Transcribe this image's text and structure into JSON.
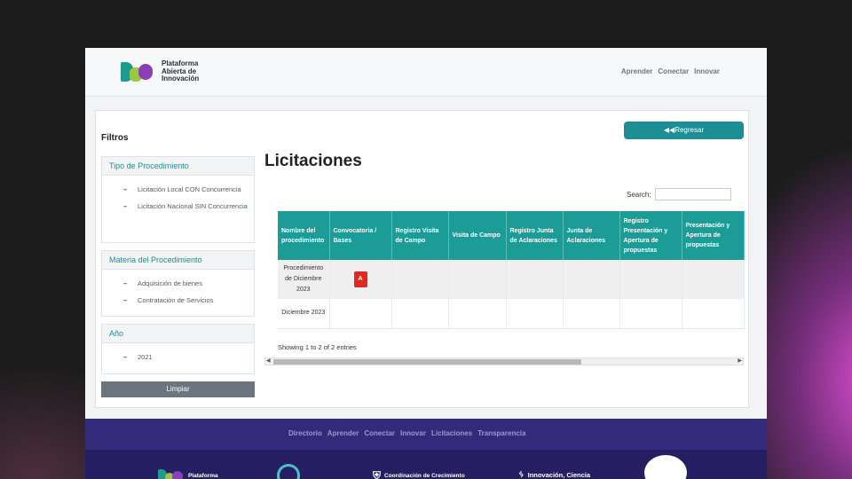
{
  "header": {
    "logo_text": "Plataforma Abierta de Innovación",
    "nav": [
      "Aprender",
      "Conectar",
      "Innovar"
    ]
  },
  "filters": {
    "title": "Filtros",
    "groups": [
      {
        "title": "Tipo de Procedimiento",
        "items": [
          "Licitación Local CON Concurrencia",
          "Licitación Nacional SIN Concurrencia"
        ]
      },
      {
        "title": "Materia del Procedimiento",
        "items": [
          "Adquisición de bienes",
          "Contratación de Servicios"
        ]
      },
      {
        "title": "Año",
        "items": [
          "2021"
        ]
      }
    ],
    "clear_label": "Limpiar"
  },
  "main": {
    "back_label": "Regresar",
    "title": "Licitaciones",
    "search_label": "Search:",
    "search_value": "",
    "columns": [
      "Nombre del procedimiento",
      "Convocatoria / Bases",
      "Registro Visita de Campo",
      "Visita de Campo",
      "Registro Junta de Aclaraciones",
      "Junta de Aclaraciones",
      "Registro Presentación y Apertura de propuestas",
      "Presentación y Apertura de propuestas"
    ],
    "rows": [
      {
        "name": "Procedimiento de Diciembre 2023",
        "has_pdf": true
      },
      {
        "name": "Diciembre 2023",
        "has_pdf": false
      }
    ],
    "showing_text": "Showing 1 to 2 of 2 entries",
    "pdf_icon": "pdf-icon"
  },
  "footer": {
    "nav": [
      "Directorio",
      "Aprender",
      "Conectar",
      "Innovar",
      "Licitaciones",
      "Transparencia"
    ],
    "logos": [
      "Plataforma",
      "Coordinación de Crecimiento",
      "Innovación, Ciencia"
    ]
  }
}
